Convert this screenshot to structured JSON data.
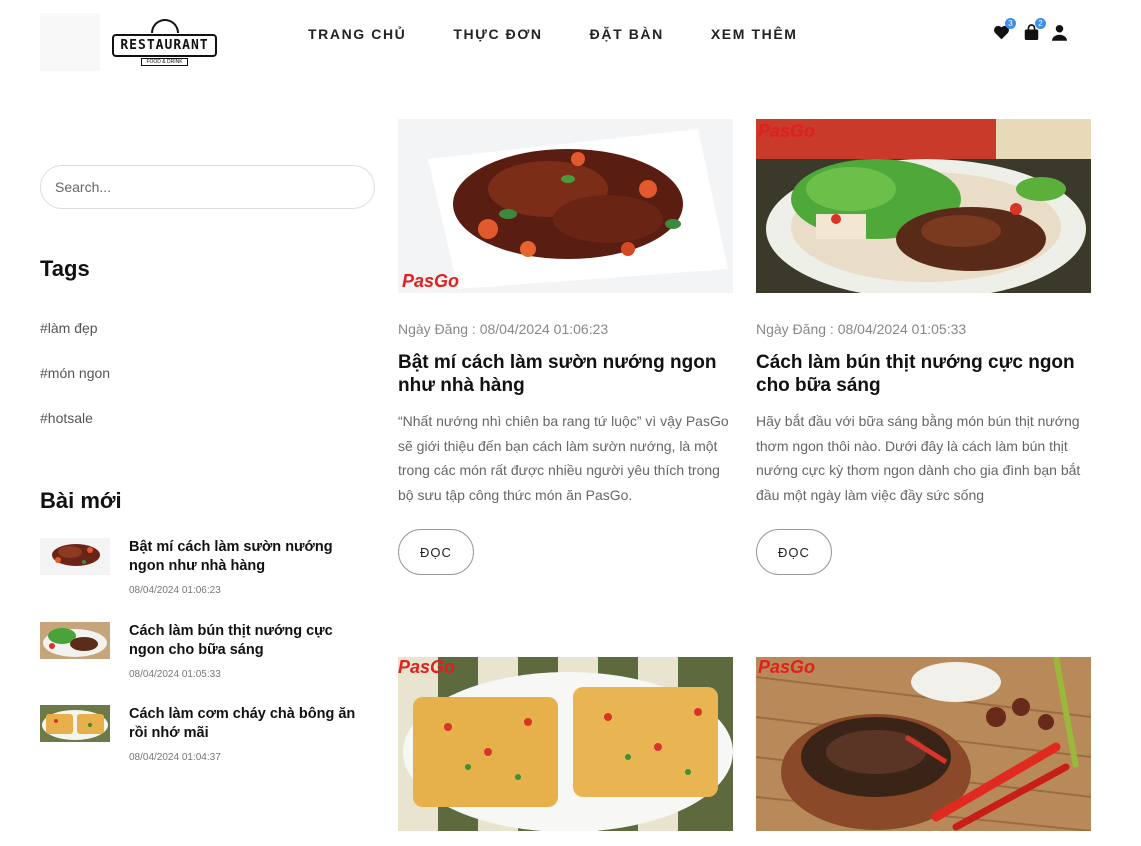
{
  "header": {
    "logo_text": "RESTAURANT",
    "logo_tagline": "FOOD & DRINK",
    "nav": [
      "TRANG CHỦ",
      "THỰC ĐƠN",
      "ĐẶT BÀN",
      "XEM THÊM"
    ],
    "wishlist_count": "3",
    "cart_count": "2",
    "icons": [
      "heart-icon",
      "shopping-bag-icon",
      "user-icon"
    ],
    "badge_color": "#3f8fe6"
  },
  "sidebar": {
    "search_placeholder": "Search...",
    "tags_title": "Tags",
    "tags": [
      "#làm đẹp",
      "#món ngon",
      "#hotsale"
    ],
    "recent_title": "Bài mới",
    "recent": [
      {
        "title": "Bật mí cách làm sườn nướng ngon như nhà hàng",
        "date": "08/04/2024 01:06:23"
      },
      {
        "title": "Cách làm bún thịt nướng cực ngon cho bữa sáng",
        "date": "08/04/2024 01:05:33"
      },
      {
        "title": "Cách làm cơm cháy chà bông ăn rồi nhớ mãi",
        "date": "08/04/2024 01:04:37"
      }
    ]
  },
  "posts": [
    {
      "image_label": "PasGo",
      "date": "Ngày Đăng : 08/04/2024 01:06:23",
      "title": "Bật mí cách làm sườn nướng ngon như nhà hàng",
      "excerpt": "“Nhất nướng nhì chiên ba rang tứ luộc” vì vậy PasGo sẽ giới thiệu đến bạn cách làm sườn nướng, là một trong các món rất được nhiều người yêu thích trong bộ sưu tập công thức món ăn PasGo.",
      "button": "ĐỌC"
    },
    {
      "image_label": "PasGo",
      "date": "Ngày Đăng : 08/04/2024 01:05:33",
      "title": "Cách làm bún thịt nướng cực ngon cho bữa sáng",
      "excerpt": "Hãy bắt đầu với bữa sáng bằng món bún thịt nướng thơm ngon thôi nào. Dưới đây là cách làm bún thịt nướng cực kỳ thơm ngon dành cho gia đình bạn bắt đầu một ngày làm việc đầy sức sống",
      "button": "ĐỌC"
    },
    {
      "image_label": "PasGo"
    },
    {
      "image_label": "PasGo"
    }
  ]
}
